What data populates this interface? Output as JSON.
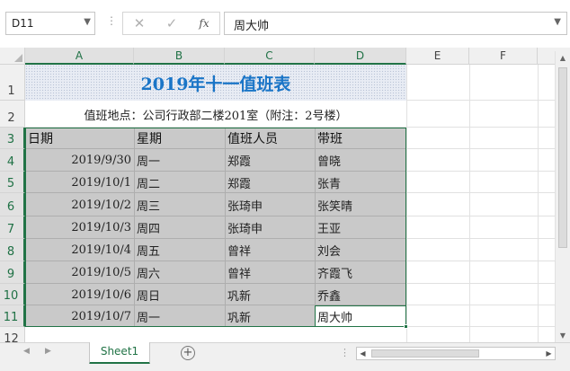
{
  "formula_bar": {
    "name_box": "D11",
    "more_icon": "⋮",
    "cancel_icon": "✕",
    "confirm_icon": "✓",
    "function_icon": "fx",
    "formula_value": "周大帅"
  },
  "columns": [
    "A",
    "B",
    "C",
    "D",
    "E",
    "F"
  ],
  "rows": [
    "1",
    "2",
    "3",
    "4",
    "5",
    "6",
    "7",
    "8",
    "9",
    "10",
    "11",
    "12"
  ],
  "sheet": {
    "title": "2019年十一值班表",
    "location": "值班地点：公司行政部二楼201室（附注：2号楼）",
    "headers": [
      "日期",
      "星期",
      "值班人员",
      "带班"
    ],
    "data": [
      [
        "2019/9/30",
        "周一",
        "郑霞",
        "曾晓"
      ],
      [
        "2019/10/1",
        "周二",
        "郑霞",
        "张青"
      ],
      [
        "2019/10/2",
        "周三",
        "张琦申",
        "张笑晴"
      ],
      [
        "2019/10/3",
        "周四",
        "张琦申",
        "王亚"
      ],
      [
        "2019/10/4",
        "周五",
        "曾祥",
        "刘会"
      ],
      [
        "2019/10/5",
        "周六",
        "曾祥",
        "齐霞飞"
      ],
      [
        "2019/10/6",
        "周日",
        "巩新",
        "乔鑫"
      ],
      [
        "2019/10/7",
        "周一",
        "巩新",
        "周大帅"
      ]
    ]
  },
  "tabs": {
    "active_sheet": "Sheet1",
    "add_label": "+"
  },
  "colors": {
    "accent": "#217346",
    "title": "#1a75c7",
    "table_fill": "#c9c9c9"
  }
}
